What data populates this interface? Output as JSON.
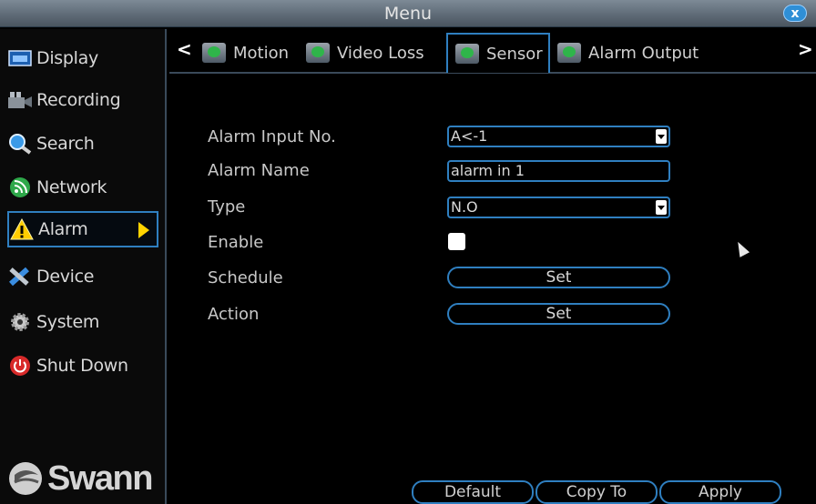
{
  "window": {
    "title": "Menu",
    "close_label": "x"
  },
  "sidebar": {
    "items": [
      {
        "label": "Display",
        "icon": "display-icon"
      },
      {
        "label": "Recording",
        "icon": "recording-icon"
      },
      {
        "label": "Search",
        "icon": "search-icon"
      },
      {
        "label": "Network",
        "icon": "network-icon"
      },
      {
        "label": "Alarm",
        "icon": "alarm-icon",
        "active": true
      },
      {
        "label": "Device",
        "icon": "device-icon"
      },
      {
        "label": "System",
        "icon": "system-icon"
      },
      {
        "label": "Shut Down",
        "icon": "power-icon"
      }
    ],
    "logo": "Swann"
  },
  "tabs": {
    "prev": "<",
    "next": ">",
    "items": [
      {
        "label": "Motion"
      },
      {
        "label": "Video Loss"
      },
      {
        "label": "Sensor",
        "active": true
      },
      {
        "label": "Alarm Output"
      }
    ]
  },
  "form": {
    "alarm_input_label": "Alarm Input No.",
    "alarm_input_value": "A<-1",
    "alarm_name_label": "Alarm Name",
    "alarm_name_value": "alarm in 1",
    "type_label": "Type",
    "type_value": "N.O",
    "enable_label": "Enable",
    "enable_checked": true,
    "schedule_label": "Schedule",
    "schedule_button": "Set",
    "action_label": "Action",
    "action_button": "Set"
  },
  "buttons": {
    "default": "Default",
    "copy_to": "Copy To",
    "apply": "Apply"
  },
  "colors": {
    "accent": "#2f7fc0",
    "arrow": "#ffd400",
    "close": "#2f8fd6"
  }
}
